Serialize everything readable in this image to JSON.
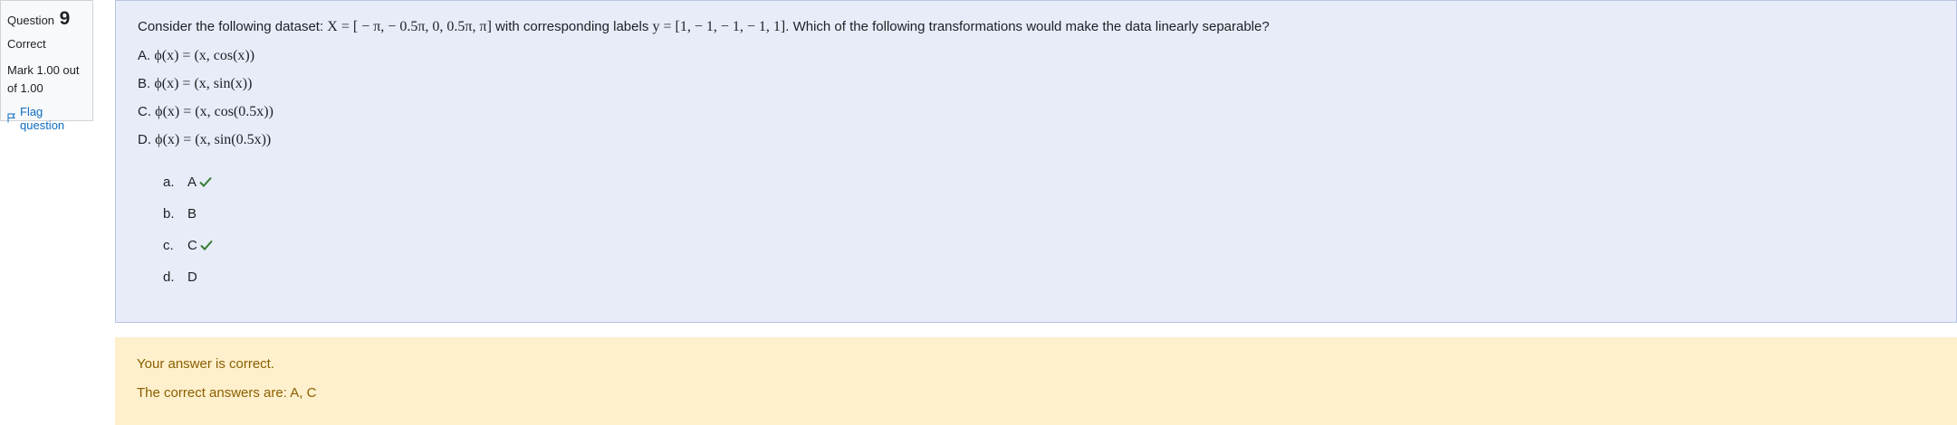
{
  "info": {
    "question_label": "Question",
    "question_number": "9",
    "state": "Correct",
    "grade": "Mark 1.00 out of 1.00",
    "flag_label": "Flag question"
  },
  "question": {
    "text_before_x": "Consider the following dataset: ",
    "x_expr": "X = [ − π,  − 0.5π, 0, 0.5π, π]",
    "text_between": " with corresponding labels ",
    "y_expr": "y = [1,  − 1,  − 1,  − 1, 1]",
    "text_after": ". Which of the following transformations would make the data linearly separable?",
    "options": [
      {
        "prefix": "A. ",
        "formula": "ϕ(x) = (x, cos(x))"
      },
      {
        "prefix": "B. ",
        "formula": "ϕ(x) = (x, sin(x))"
      },
      {
        "prefix": "C. ",
        "formula": "ϕ(x) = (x, cos(0.5x))"
      },
      {
        "prefix": "D. ",
        "formula": "ϕ(x) = (x, sin(0.5x))"
      }
    ]
  },
  "answers": [
    {
      "letter": "a.",
      "label": "A",
      "correct": true
    },
    {
      "letter": "b.",
      "label": "B",
      "correct": false
    },
    {
      "letter": "c.",
      "label": "C",
      "correct": true
    },
    {
      "letter": "d.",
      "label": "D",
      "correct": false
    }
  ],
  "feedback": {
    "status": "Your answer is correct.",
    "right_answer": "The correct answers are: A, C"
  },
  "colors": {
    "tick": "#357a32",
    "link": "#0f6cbf",
    "feedback_text": "#8a5e00"
  }
}
